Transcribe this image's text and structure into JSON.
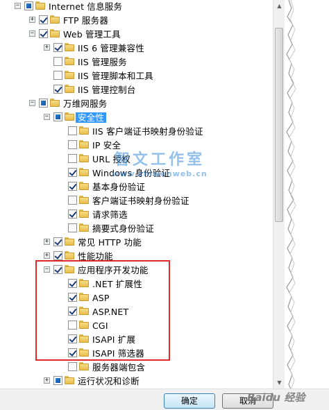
{
  "tree": {
    "items": [
      {
        "label": "Internet 信息服务",
        "expander": "−",
        "state": "partial",
        "level": 0
      },
      {
        "label": "FTP 服务器",
        "expander": "+",
        "state": "checked",
        "level": 1
      },
      {
        "label": "Web 管理工具",
        "expander": "−",
        "state": "checked",
        "level": 1
      },
      {
        "label": "IIS 6 管理兼容性",
        "expander": "+",
        "state": "checked",
        "level": 2
      },
      {
        "label": "IIS 管理服务",
        "expander": "",
        "state": "unchecked",
        "level": 2
      },
      {
        "label": "IIS 管理脚本和工具",
        "expander": "",
        "state": "unchecked",
        "level": 2
      },
      {
        "label": "IIS 管理控制台",
        "expander": "",
        "state": "checked",
        "level": 2
      },
      {
        "label": "万维网服务",
        "expander": "−",
        "state": "partial",
        "level": 1
      },
      {
        "label": "安全性",
        "expander": "−",
        "state": "partial",
        "level": 2,
        "selected": true
      },
      {
        "label": "IIS 客户端证书映射身份验证",
        "expander": "",
        "state": "unchecked",
        "level": 3
      },
      {
        "label": "IP 安全",
        "expander": "",
        "state": "unchecked",
        "level": 3
      },
      {
        "label": "URL 授权",
        "expander": "",
        "state": "unchecked",
        "level": 3
      },
      {
        "label": "Windows 身份验证",
        "expander": "",
        "state": "checked",
        "level": 3
      },
      {
        "label": "基本身份验证",
        "expander": "",
        "state": "checked",
        "level": 3
      },
      {
        "label": "客户端证书映射身份验证",
        "expander": "",
        "state": "unchecked",
        "level": 3
      },
      {
        "label": "请求筛选",
        "expander": "",
        "state": "checked",
        "level": 3
      },
      {
        "label": "摘要式身份验证",
        "expander": "",
        "state": "unchecked",
        "level": 3
      },
      {
        "label": "常见 HTTP 功能",
        "expander": "+",
        "state": "checked",
        "level": 2
      },
      {
        "label": "性能功能",
        "expander": "+",
        "state": "checked",
        "level": 2
      },
      {
        "label": "应用程序开发功能",
        "expander": "−",
        "state": "checked",
        "level": 2
      },
      {
        "label": ".NET 扩展性",
        "expander": "",
        "state": "checked",
        "level": 3
      },
      {
        "label": "ASP",
        "expander": "",
        "state": "checked",
        "level": 3
      },
      {
        "label": "ASP.NET",
        "expander": "",
        "state": "checked",
        "level": 3
      },
      {
        "label": "CGI",
        "expander": "",
        "state": "unchecked",
        "level": 3
      },
      {
        "label": "ISAPI 扩展",
        "expander": "",
        "state": "checked",
        "level": 3
      },
      {
        "label": "ISAPI 筛选器",
        "expander": "",
        "state": "checked",
        "level": 3
      },
      {
        "label": "服务器端包含",
        "expander": "",
        "state": "unchecked",
        "level": 3
      },
      {
        "label": "运行状况和诊断",
        "expander": "+",
        "state": "partial",
        "level": 2
      }
    ]
  },
  "watermark": {
    "line1": "智文工作室",
    "line2": "www.zhiwenweb.cn"
  },
  "buttons": {
    "ok": "确定",
    "cancel": "取消"
  },
  "baidu_mark": "Baidu 经验",
  "colors": {
    "selection": "#3399ff",
    "highlight_box": "#e02a2a"
  }
}
